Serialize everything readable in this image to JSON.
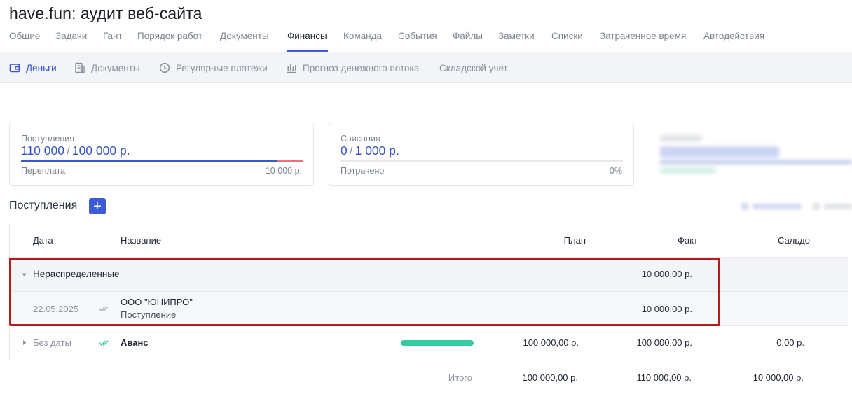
{
  "project_title": "have.fun: аудит веб-сайта",
  "tabs": [
    {
      "label": "Общие"
    },
    {
      "label": "Задачи"
    },
    {
      "label": "Гант"
    },
    {
      "label": "Порядок работ"
    },
    {
      "label": "Документы"
    },
    {
      "label": "Финансы",
      "active": true
    },
    {
      "label": "Команда"
    },
    {
      "label": "События"
    },
    {
      "label": "Файлы"
    },
    {
      "label": "Заметки"
    },
    {
      "label": "Списки"
    },
    {
      "label": "Затраченное время"
    },
    {
      "label": "Автодействия"
    }
  ],
  "subnav": [
    {
      "label": "Деньги",
      "icon": "wallet-icon",
      "active": true
    },
    {
      "label": "Документы",
      "icon": "document-icon"
    },
    {
      "label": "Регулярные платежи",
      "icon": "clock-icon"
    },
    {
      "label": "Прогноз денежного потока",
      "icon": "bar-chart-icon"
    },
    {
      "label": "Складской учет",
      "icon": ""
    }
  ],
  "cards": {
    "income": {
      "label": "Поступления",
      "actual": "110 000",
      "separator": "/",
      "plan": "100 000 р.",
      "footer_label": "Переплата",
      "footer_value": "10 000 р.",
      "progress_fraction": 0.909,
      "overpay_fraction": 0.091
    },
    "expense": {
      "label": "Списания",
      "actual": "0",
      "separator": "/",
      "plan": "1 000 р.",
      "footer_label": "Потрачено",
      "footer_value": "0%",
      "progress_fraction": 0
    }
  },
  "section": {
    "title": "Поступления",
    "add_label": "+"
  },
  "table": {
    "headers": {
      "date": "Дата",
      "name": "Название",
      "plan": "План",
      "fact": "Факт",
      "balance": "Сальдо"
    },
    "group": {
      "label": "Нераспределенные",
      "fact": "10 000,00 р."
    },
    "item": {
      "date": "22.05.2025",
      "name": "ООО \"ЮНИПРО\"",
      "type": "Поступление",
      "fact": "10 000,00 р."
    },
    "nodate": {
      "date": "Без даты",
      "name": "Аванс",
      "plan": "100 000,00 р.",
      "fact": "100 000,00 р.",
      "balance": "0,00 р.",
      "progress_fraction": 1
    },
    "totals": {
      "label": "Итого",
      "plan": "100 000,00 р.",
      "fact": "110 000,00 р.",
      "balance": "10 000,00 р."
    }
  },
  "colors": {
    "accent": "#3b5bd9",
    "overpay": "#ef6f7f",
    "success": "#38cba2",
    "highlight": "#b31c1c"
  }
}
